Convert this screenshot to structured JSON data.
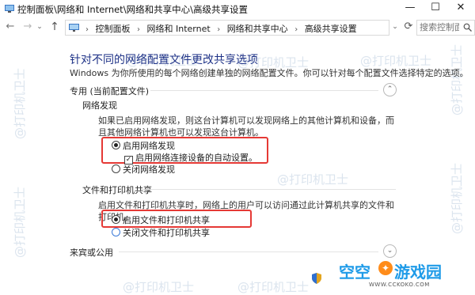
{
  "window": {
    "title": "控制面板\\网络和 Internet\\网络和共享中心\\高级共享设置",
    "min": "—",
    "max": "☐",
    "close": "✕"
  },
  "nav": {
    "back": "←",
    "forward": "→",
    "history": "⌄",
    "up": "↑",
    "dropdown": "⌄",
    "refresh": "⟳"
  },
  "address": {
    "crumbs": [
      "控制面板",
      "网络和 Internet",
      "网络和共享中心",
      "高级共享设置"
    ],
    "separator": "›"
  },
  "search": {
    "placeholder": "搜索控制面"
  },
  "main": {
    "heading": "针对不同的网络配置文件更改共享选项",
    "description": "Windows 为你所使用的每个网络创建单独的网络配置文件。你可以针对每个配置文件选择特定的选项。",
    "private_section": {
      "header": "专用 (当前配置文件)",
      "collapse_glyph": "⌃",
      "network_discovery": {
        "header": "网络发现",
        "description": "如果已启用网络发现，则这台计算机可以发现网络上的其他计算机和设备，而且其他网络计算机也可以发现这台计算机。",
        "option_on": "启用网络发现",
        "auto_setup": "启用网络连接设备的自动设置。",
        "option_off": "关闭网络发现"
      },
      "file_printer_sharing": {
        "header": "文件和打印机共享",
        "description": "启用文件和打印机共享时，网络上的用户可以访问通过此计算机共享的文件和打印机。",
        "option_on": "启用文件和打印机共享",
        "option_off": "关闭文件和打印机共享"
      }
    },
    "guest_section": {
      "header": "来宾或公用",
      "collapse_glyph": "⌄"
    }
  },
  "watermarks": {
    "text": "@打印机卫士",
    "brand_part1": "空空",
    "brand_dot": "✦",
    "brand_part2": "游戏园",
    "brand_url": "WWW.CCKOKO.COM"
  },
  "colors": {
    "heading": "#1e3287",
    "highlight": "#e53935",
    "brand": "#1f9be8",
    "brand_accent": "#ff8c1a"
  }
}
